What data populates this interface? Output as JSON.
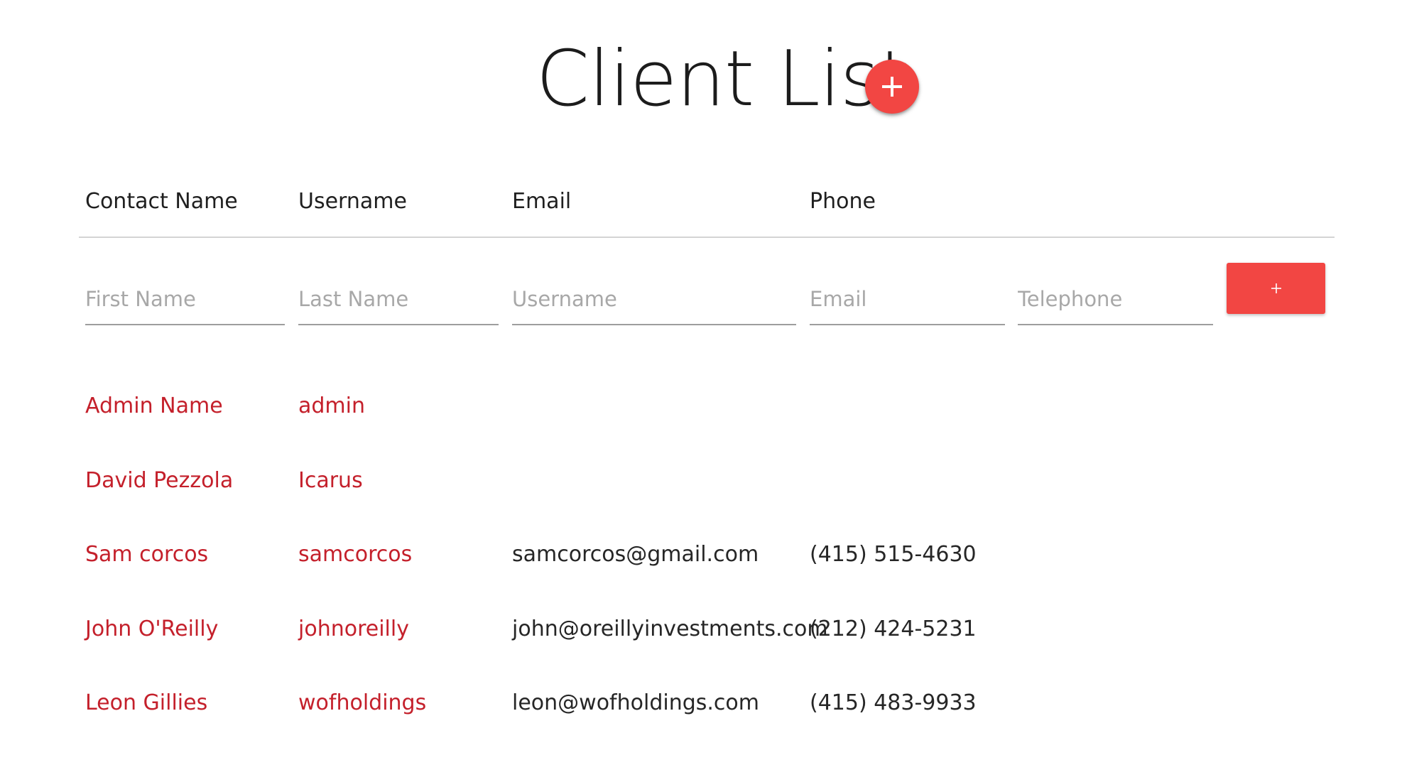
{
  "header": {
    "title": "Client List",
    "add_button_icon": "plus-icon"
  },
  "columns": {
    "contact_name": "Contact Name",
    "username": "Username",
    "email": "Email",
    "phone": "Phone"
  },
  "new_client_form": {
    "first_name_placeholder": "First Name",
    "last_name_placeholder": "Last Name",
    "username_placeholder": "Username",
    "email_placeholder": "Email",
    "telephone_placeholder": "Telephone",
    "submit_icon": "plus-icon"
  },
  "clients": [
    {
      "name": "Admin Name",
      "username": "admin",
      "email": "",
      "phone": ""
    },
    {
      "name": "David Pezzola",
      "username": "Icarus",
      "email": "",
      "phone": ""
    },
    {
      "name": "Sam corcos",
      "username": "samcorcos",
      "email": "samcorcos@gmail.com",
      "phone": "(415) 515-4630"
    },
    {
      "name": "John O'Reilly",
      "username": "johnoreilly",
      "email": "john@oreillyinvestments.com",
      "phone": "(212) 424-5231"
    },
    {
      "name": "Leon Gillies",
      "username": "wofholdings",
      "email": "leon@wofholdings.com",
      "phone": "(415) 483-9933"
    }
  ],
  "colors": {
    "accent": "#f24643",
    "link": "#c4202b",
    "divider": "#d4d4d4"
  }
}
